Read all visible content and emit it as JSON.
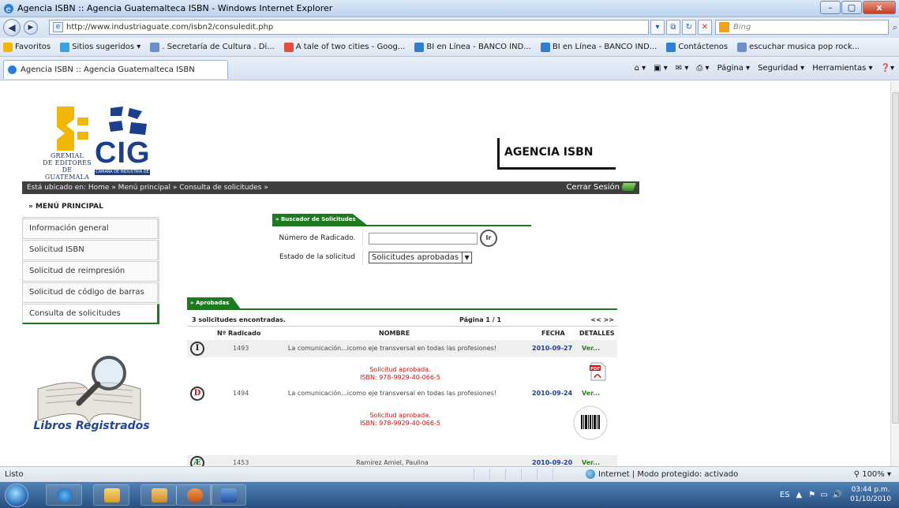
{
  "window": {
    "title": "Agencia ISBN :: Agencia Guatemalteca ISBN - Windows Internet Explorer",
    "buttons": [
      "–",
      "▢",
      "x"
    ]
  },
  "address": {
    "url": "http://www.industriaguate.com/isbn2/consuledit.php",
    "search_placeholder": "Bing"
  },
  "favorites": [
    {
      "label": "Favoritos",
      "icon": "star-icon"
    },
    {
      "label": "Sitios sugeridos ▾",
      "icon": "suggested-sites-icon"
    },
    {
      "label": ". Secretaría de Cultura . Di...",
      "icon": "page-icon"
    },
    {
      "label": "A tale of two cities - Goog...",
      "icon": "google-icon"
    },
    {
      "label": "BI en Línea - BANCO IND...",
      "icon": "ie-page-icon"
    },
    {
      "label": "BI en Línea - BANCO IND...",
      "icon": "ie-page-icon"
    },
    {
      "label": "Contáctenos",
      "icon": "ie-page-icon"
    },
    {
      "label": "escuchar musica pop rock...",
      "icon": "page-icon"
    }
  ],
  "tab": {
    "label": "Agencia ISBN :: Agencia Guatemalteca ISBN"
  },
  "commands": [
    "Página ▾",
    "Seguridad ▾",
    "Herramientas ▾"
  ],
  "logo": {
    "gremial": [
      "GREMIAL",
      "DE EDITORES",
      "DE GUATEMALA"
    ],
    "cig": "CIG",
    "cig_sub": "CÁMARA DE INDUSTRIA DE GUATEMALA"
  },
  "header": {
    "agency": "AGENCIA ISBN"
  },
  "breadcrumb": {
    "text": "Está ubicado en: Home » Menú principal » Consulta de solicitudes »",
    "logout": "Cerrar Sesión"
  },
  "sidebar": {
    "title": "» MENÚ PRINCIPAL",
    "items": [
      {
        "label": "Información general",
        "active": false
      },
      {
        "label": "Solicitud ISBN",
        "active": false
      },
      {
        "label": "Solicitud de reimpresión",
        "active": false
      },
      {
        "label": "Solicitud de código de barras",
        "active": false
      },
      {
        "label": "Consulta de solicitudes",
        "active": true
      }
    ],
    "banner": "Libros Registrados"
  },
  "searcher": {
    "title": "» Buscador de Solicitudes",
    "field1_label": "Número de Radicado.",
    "field1_value": "",
    "go_button": "Ir",
    "field2_label": "Estado de la solicitud",
    "field2_value": "Solicitudes aprobadas"
  },
  "results": {
    "section": "» Aprobadas",
    "count_text": "3 solicitudes encontradas.",
    "page_text": "Página 1 / 1",
    "pager": "<< >>",
    "columns": {
      "radicado": "Nº Radicado",
      "nombre": "NOMBRE",
      "fecha": "FECHA",
      "detalles": "DETALLES"
    },
    "rows": [
      {
        "icon": "I",
        "radicado": "1493",
        "nombre": "La comunicación...icomo eje transversal en todas las profesiones!",
        "fecha": "2010-09-27",
        "detalle": "Ver...",
        "status1": "Solicitud aprobada.",
        "status2": "ISBN: 978-9929-40-066-5",
        "attachment": "pdf-icon"
      },
      {
        "icon": "D",
        "radicado": "1494",
        "nombre": "La comunicación...icomo eje transversal en todas las profesiones!",
        "fecha": "2010-09-24",
        "detalle": "Ver...",
        "status1": "Solicitud aprobada.",
        "status2": "ISBN: 978-9929-40-066-5",
        "attachment": "barcode-icon"
      },
      {
        "icon": "Æ",
        "radicado": "1453",
        "nombre": "Ramírez Amiel, Paulina",
        "fecha": "2010-09-20",
        "detalle": "Ver..."
      }
    ]
  },
  "status": {
    "left": "Listo",
    "zone": "Internet | Modo protegido: activado",
    "zoom": "100%"
  },
  "taskbar": {
    "lang": "ES",
    "time": "03:44 p.m.",
    "date": "01/10/2010"
  },
  "colors": {
    "green": "#1e7a1e",
    "navy": "#1e3d8f",
    "red": "#d10f0f"
  }
}
